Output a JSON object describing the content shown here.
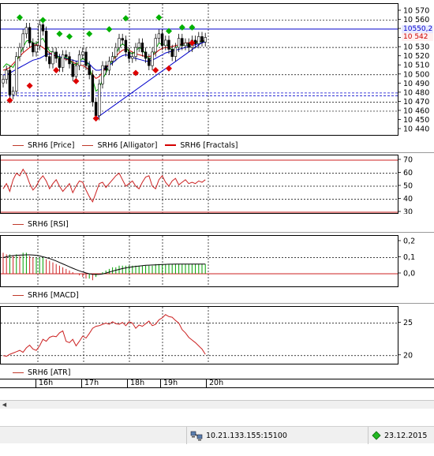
{
  "price": {
    "y_ticks": [
      "10 570",
      "10 560",
      "10 550",
      "10 540",
      "10 530",
      "10 520",
      "10 510",
      "10 500",
      "10 490",
      "10 480",
      "10 470",
      "10 460",
      "10 450",
      "10 440"
    ],
    "last_price_label": "10550,2",
    "last_price_color": "#0000cc",
    "bid_label": "10 542",
    "bid_color": "#cc0000",
    "legend": [
      {
        "label": "SRH6 [Price]",
        "style": "thin"
      },
      {
        "label": "SRH6 [Alligator]",
        "style": "thin"
      },
      {
        "label": "SRH6 [Fractals]",
        "style": "thick"
      }
    ]
  },
  "rsi": {
    "y_ticks": [
      "70",
      "60",
      "50",
      "40",
      "30"
    ],
    "upper_level": 70,
    "lower_level": 30,
    "legend": "SRH6 [RSI]"
  },
  "macd": {
    "y_ticks": [
      "0,2",
      "0,1",
      "0,0"
    ],
    "legend": "SRH6 [MACD]"
  },
  "atr": {
    "y_ticks": [
      "25",
      "20"
    ],
    "legend": "SRH6 [ATR]"
  },
  "time_axis": {
    "labels": [
      "16h",
      "17h",
      "18h",
      "19h",
      "20h"
    ]
  },
  "statusbar": {
    "connection_icon": "network-computer-icon",
    "connection_text": "10.21.133.155:15100",
    "status_icon": "green-diamond-icon",
    "date_text": "23.12.2015"
  },
  "colors": {
    "bull_candle": "#ffffff",
    "bear_candle": "#000000",
    "alligator_jaw": "#0000cc",
    "alligator_teeth": "#cc0000",
    "alligator_lips": "#00aa00",
    "fractal_up": "#00b000",
    "fractal_down": "#dd0000",
    "trend_line": "#0000cc",
    "indicator_line": "#cc2222"
  },
  "chart_data": [
    {
      "type": "line",
      "title": "SRH6 [Price]",
      "ylim": [
        10440,
        10570
      ],
      "x_labels": [
        "16h",
        "17h",
        "18h",
        "19h",
        "20h"
      ],
      "close": [
        10495,
        10505,
        10478,
        10482,
        10520,
        10530,
        10545,
        10552,
        10535,
        10525,
        10532,
        10555,
        10548,
        10520,
        10512,
        10525,
        10518,
        10508,
        10522,
        10520,
        10512,
        10498,
        10510,
        10522,
        10525,
        10510,
        10500,
        10470,
        10455,
        10490,
        10510,
        10505,
        10515,
        10520,
        10530,
        10540,
        10538,
        10525,
        10518,
        10520,
        10530,
        10535,
        10525,
        10518,
        10510,
        10525,
        10540,
        10545,
        10532,
        10538,
        10528,
        10520,
        10530,
        10540,
        10532,
        10535,
        10530,
        10538,
        10534,
        10542,
        10536,
        10541
      ],
      "alligator_jaw": [
        10500,
        10500,
        10502,
        10504,
        10506,
        10508,
        10510,
        10512,
        10514,
        10516,
        10517,
        10518,
        10520,
        10522,
        10523,
        10522,
        10521,
        10520,
        10519,
        10518,
        10517,
        10516,
        10515,
        10515,
        10515,
        10514,
        10512,
        10508,
        10505,
        10505,
        10506,
        10508,
        10510,
        10513,
        10516,
        10519,
        10521,
        10522,
        10521,
        10519,
        10518,
        10517,
        10516,
        10515,
        10515,
        10516,
        10518,
        10520,
        10522,
        10524,
        10525,
        10526,
        10527,
        10528,
        10529,
        10530,
        10531,
        10532,
        10533,
        10534,
        10535,
        10536
      ],
      "alligator_teeth": [
        10505,
        10506,
        10508,
        10512,
        10516,
        10520,
        10524,
        10527,
        10530,
        10532,
        10533,
        10532,
        10530,
        10527,
        10524,
        10522,
        10520,
        10519,
        10518,
        10517,
        10516,
        10514,
        10512,
        10511,
        10510,
        10508,
        10505,
        10500,
        10496,
        10498,
        10503,
        10508,
        10512,
        10516,
        10520,
        10524,
        10527,
        10528,
        10527,
        10525,
        10523,
        10522,
        10521,
        10520,
        10520,
        10521,
        10524,
        10527,
        10529,
        10530,
        10530,
        10531,
        10532,
        10533,
        10534,
        10535,
        10535,
        10536,
        10536,
        10537,
        10537,
        10538
      ],
      "alligator_lips": [
        10508,
        10512,
        10510,
        10508,
        10515,
        10522,
        10530,
        10537,
        10538,
        10535,
        10534,
        10538,
        10540,
        10533,
        10526,
        10525,
        10522,
        10518,
        10519,
        10519,
        10517,
        10512,
        10511,
        10515,
        10518,
        10515,
        10510,
        10495,
        10482,
        10485,
        10495,
        10502,
        10510,
        10516,
        10523,
        10530,
        10534,
        10531,
        10525,
        10523,
        10526,
        10530,
        10528,
        10522,
        10517,
        10520,
        10528,
        10535,
        10533,
        10534,
        10531,
        10527,
        10529,
        10533,
        10532,
        10533,
        10532,
        10534,
        10534,
        10537,
        10536,
        10538
      ],
      "fractals_up": [
        [
          5,
          10563
        ],
        [
          12,
          10560
        ],
        [
          17,
          10545
        ],
        [
          20,
          10542
        ],
        [
          26,
          10545
        ],
        [
          32,
          10550
        ],
        [
          37,
          10562
        ],
        [
          47,
          10563
        ],
        [
          50,
          10548
        ],
        [
          54,
          10552
        ],
        [
          57,
          10552
        ]
      ],
      "fractals_down": [
        [
          2,
          10472
        ],
        [
          8,
          10488
        ],
        [
          16,
          10505
        ],
        [
          22,
          10493
        ],
        [
          28,
          10452
        ],
        [
          40,
          10502
        ],
        [
          46,
          10505
        ],
        [
          50,
          10507
        ],
        [
          57,
          10535
        ]
      ]
    },
    {
      "type": "line",
      "title": "SRH6 [RSI]",
      "ylim": [
        30,
        70
      ],
      "values": [
        48,
        52,
        46,
        55,
        60,
        58,
        63,
        59,
        52,
        47,
        50,
        55,
        58,
        54,
        48,
        52,
        55,
        50,
        46,
        49,
        52,
        45,
        50,
        54,
        53,
        47,
        42,
        38,
        45,
        52,
        53,
        49,
        52,
        55,
        58,
        60,
        55,
        50,
        52,
        54,
        50,
        48,
        53,
        57,
        58,
        50,
        48,
        55,
        58,
        53,
        50,
        54,
        56,
        51,
        53,
        55,
        52,
        53,
        52,
        54,
        53,
        55
      ]
    },
    {
      "type": "bar",
      "title": "SRH6 [MACD]",
      "ylim": [
        -0.05,
        0.2
      ],
      "histogram": [
        0.13,
        0.12,
        0.12,
        0.11,
        0.12,
        0.11,
        0.13,
        0.13,
        0.11,
        0.1,
        0.1,
        0.1,
        0.1,
        0.09,
        0.08,
        0.07,
        0.06,
        0.05,
        0.04,
        0.03,
        0.02,
        0.01,
        0.0,
        -0.01,
        -0.02,
        -0.03,
        -0.03,
        -0.04,
        -0.02,
        0.0,
        0.01,
        0.02,
        0.03,
        0.04,
        0.04,
        0.05,
        0.05,
        0.05,
        0.05,
        0.05,
        0.05,
        0.05,
        0.05,
        0.05,
        0.05,
        0.05,
        0.06,
        0.06,
        0.06,
        0.06,
        0.06,
        0.06,
        0.06,
        0.06,
        0.06,
        0.06,
        0.06,
        0.06,
        0.06,
        0.06,
        0.06,
        0.06
      ],
      "signal": [
        0.1,
        0.105,
        0.11,
        0.112,
        0.114,
        0.115,
        0.116,
        0.117,
        0.117,
        0.116,
        0.114,
        0.11,
        0.105,
        0.1,
        0.094,
        0.087,
        0.079,
        0.07,
        0.061,
        0.052,
        0.043,
        0.034,
        0.026,
        0.018,
        0.011,
        0.005,
        0.0,
        -0.004,
        -0.005,
        -0.004,
        -0.001,
        0.004,
        0.01,
        0.016,
        0.022,
        0.027,
        0.032,
        0.036,
        0.04,
        0.043,
        0.046,
        0.048,
        0.05,
        0.052,
        0.053,
        0.054,
        0.055,
        0.056,
        0.057,
        0.058,
        0.059,
        0.059,
        0.06,
        0.06,
        0.06,
        0.06,
        0.06,
        0.06,
        0.06,
        0.06,
        0.06,
        0.06
      ]
    },
    {
      "type": "line",
      "title": "SRH6 [ATR]",
      "ylim": [
        19,
        27
      ],
      "values": [
        20.0,
        19.9,
        20.2,
        20.4,
        20.6,
        20.8,
        20.5,
        21.2,
        21.6,
        21.0,
        20.8,
        21.5,
        22.5,
        22.2,
        22.8,
        23.0,
        22.9,
        23.5,
        23.8,
        22.2,
        22.0,
        22.5,
        21.5,
        22.2,
        23.0,
        22.7,
        23.4,
        24.2,
        24.5,
        24.6,
        24.8,
        25.0,
        24.8,
        25.2,
        24.9,
        24.8,
        25.1,
        24.6,
        25.2,
        25.0,
        24.2,
        24.7,
        24.5,
        24.9,
        25.3,
        24.6,
        24.8,
        25.5,
        25.8,
        26.3,
        26.0,
        25.9,
        25.4,
        25.0,
        24.0,
        23.5,
        22.8,
        22.4,
        22.0,
        21.5,
        21.0,
        20.2
      ]
    }
  ]
}
